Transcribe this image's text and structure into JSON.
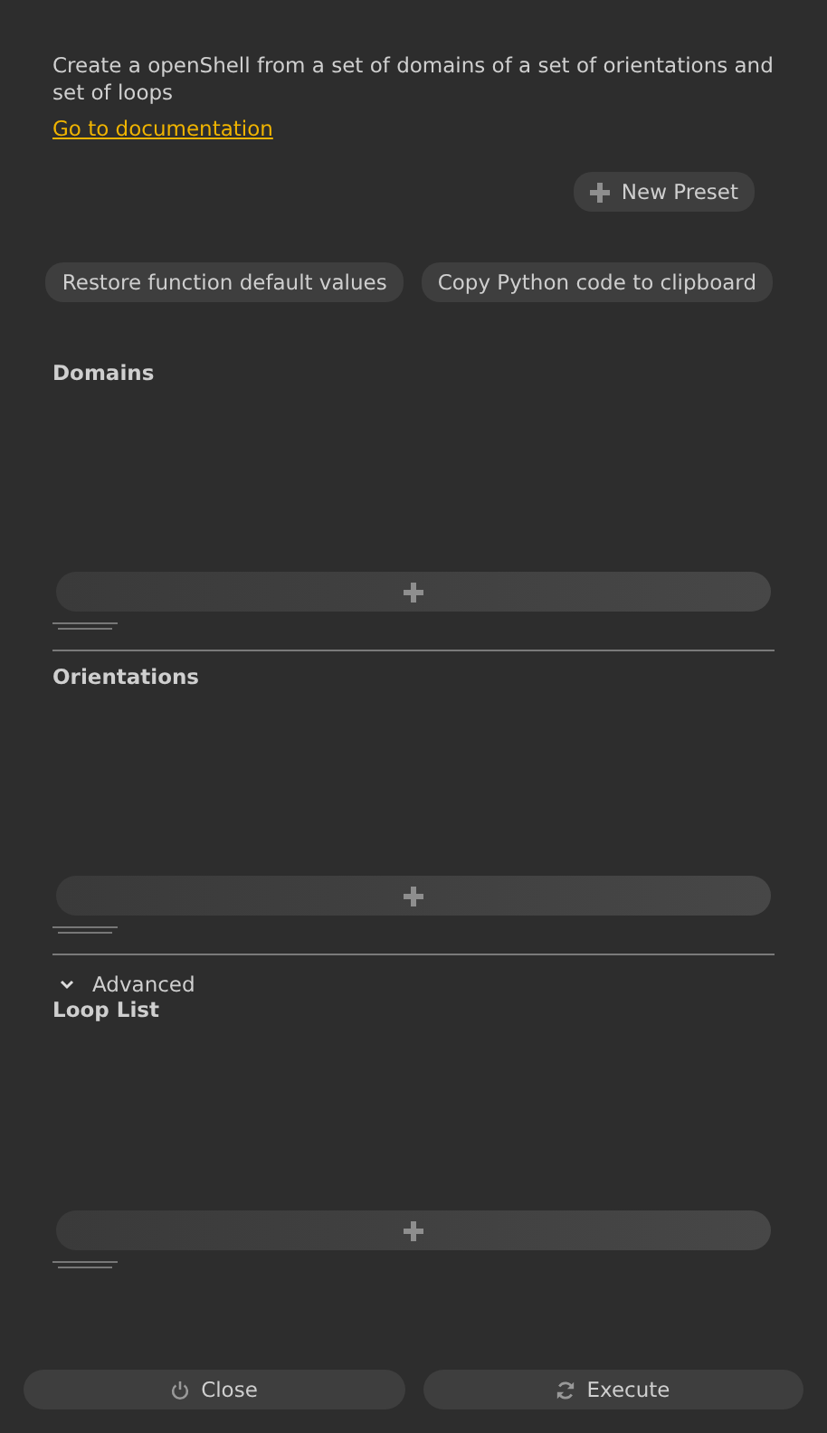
{
  "description": "Create a openShell from a set of domains of a set of orientations and set of loops",
  "doc_link": "Go to documentation",
  "preset_button": "New Preset",
  "actions": [
    "Restore function default values",
    "Copy Python code to clipboard"
  ],
  "sections": [
    {
      "label": "Domains"
    },
    {
      "label": "Orientations"
    }
  ],
  "advanced": {
    "label": "Advanced",
    "expanded": true,
    "sections": [
      {
        "label": "Loop List"
      }
    ]
  },
  "footer": [
    {
      "kind": "close",
      "label": "Close"
    },
    {
      "kind": "execute",
      "label": "Execute"
    }
  ]
}
